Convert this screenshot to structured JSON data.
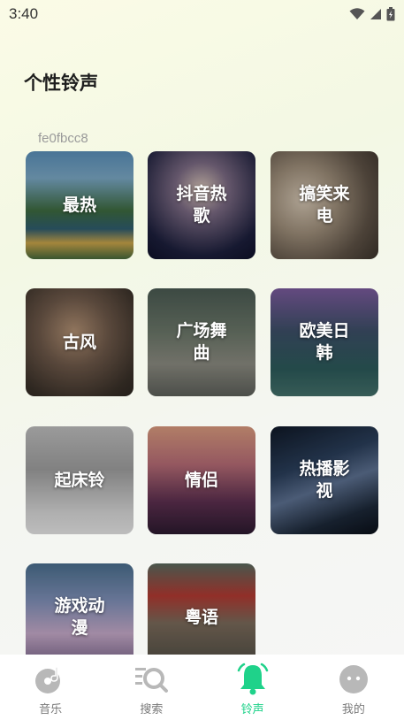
{
  "status_bar": {
    "time": "3:40"
  },
  "page": {
    "title": "个性铃声",
    "device_id": "fe0fbcc8"
  },
  "categories": [
    {
      "label": "最热"
    },
    {
      "label": "抖音热歌"
    },
    {
      "label": "搞笑来电"
    },
    {
      "label": "古风"
    },
    {
      "label": "广场舞曲"
    },
    {
      "label": "欧美日韩"
    },
    {
      "label": "起床铃"
    },
    {
      "label": "情侣"
    },
    {
      "label": "热播影视"
    },
    {
      "label": "游戏动漫"
    },
    {
      "label": "粤语"
    }
  ],
  "tabbar": {
    "items": [
      {
        "label": "音乐",
        "icon": "music-disc-icon"
      },
      {
        "label": "搜索",
        "icon": "search-icon"
      },
      {
        "label": "铃声",
        "icon": "bell-icon",
        "active": true
      },
      {
        "label": "我的",
        "icon": "profile-icon"
      }
    ]
  },
  "colors": {
    "accent": "#1fd28a",
    "inactive_icon": "#b8b8b8"
  }
}
